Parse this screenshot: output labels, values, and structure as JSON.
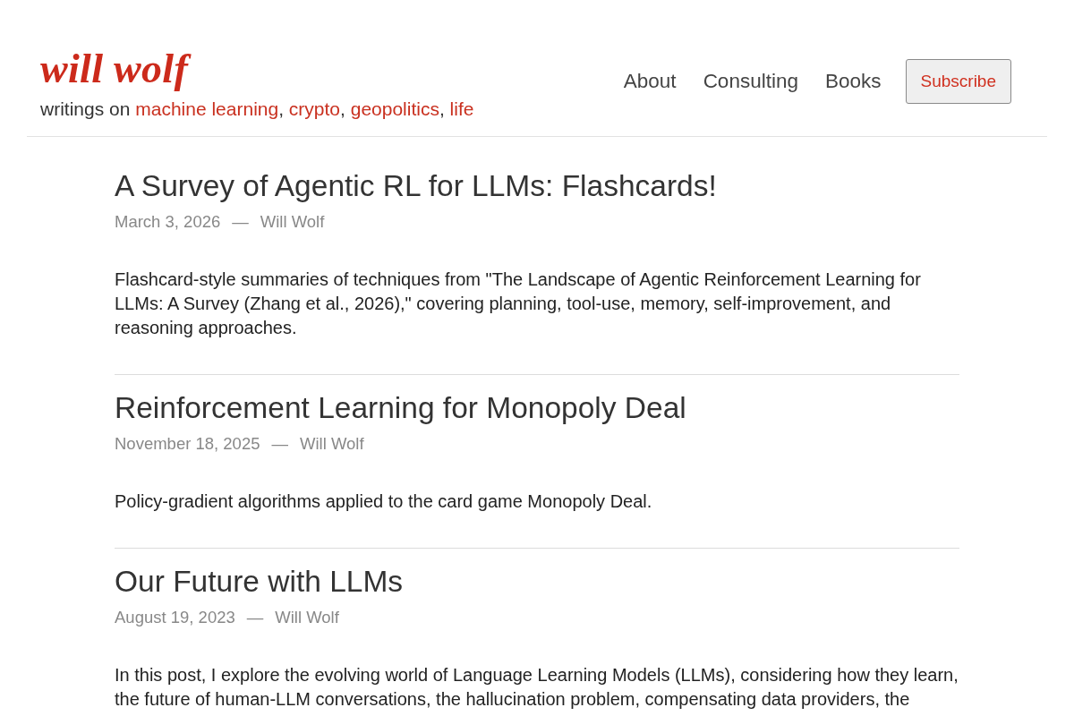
{
  "header": {
    "logo": "will wolf",
    "tagline": {
      "prefix": "writings on",
      "topics": [
        "machine learning",
        "crypto",
        "geopolitics",
        "life"
      ],
      "separator": ","
    },
    "nav": [
      "About",
      "Consulting",
      "Books"
    ],
    "subscribe_button": "Subscribe"
  },
  "posts": [
    {
      "title": "A Survey of Agentic RL for LLMs: Flashcards!",
      "date": "March 3, 2026",
      "dash": "—",
      "author": "Will Wolf",
      "excerpt": "Flashcard-style summaries of techniques from \"The Landscape of Agentic Reinforcement Learning for LLMs: A Survey (Zhang et al., 2026),\" covering planning, tool-use, memory, self-improvement, and reasoning approaches."
    },
    {
      "title": "Reinforcement Learning for Monopoly Deal",
      "date": "November 18, 2025",
      "dash": "—",
      "author": "Will Wolf",
      "excerpt": "Policy-gradient algorithms applied to the card game Monopoly Deal."
    },
    {
      "title": "Our Future with LLMs",
      "date": "August 19, 2023",
      "dash": "—",
      "author": "Will Wolf",
      "excerpt": "In this post, I explore the evolving world of Language Learning Models (LLMs), considering how they learn, the future of human-LLM conversations, the hallucination problem, compensating data providers, the"
    }
  ]
}
